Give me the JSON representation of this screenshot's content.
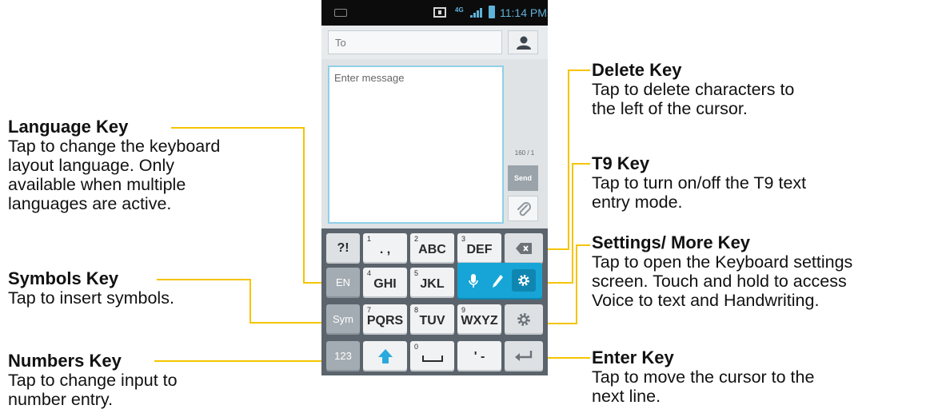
{
  "colors": {
    "leader": "#f5c400",
    "accent": "#16a5d6",
    "status_text": "#5fb2d9"
  },
  "callouts": {
    "language": {
      "title": "Language Key",
      "lines": [
        "Tap to change the keyboard",
        "layout language. Only",
        "available when multiple",
        "languages are active."
      ]
    },
    "symbols": {
      "title": "Symbols Key",
      "lines": [
        "Tap to insert symbols."
      ]
    },
    "numbers": {
      "title": "Numbers Key",
      "lines": [
        "Tap to change input to",
        "number entry."
      ]
    },
    "delete": {
      "title": "Delete Key",
      "lines": [
        "Tap to delete characters to",
        "the left of the cursor."
      ]
    },
    "t9": {
      "title": "T9 Key",
      "lines": [
        "Tap to turn on/off the T9 text",
        "entry mode."
      ]
    },
    "settings": {
      "title": "Settings/ More Key",
      "lines": [
        "Tap to open the Keyboard settings",
        "screen. Touch and hold to access",
        "Voice to text and Handwriting."
      ]
    },
    "enter": {
      "title": "Enter Key",
      "lines": [
        "Tap to move the cursor to the",
        "next line."
      ]
    }
  },
  "phone": {
    "status": {
      "network": "4G",
      "time": "11:14 PM",
      "icons": [
        "keyboard-icon",
        "sim-icon",
        "signal-icon",
        "battery-icon"
      ]
    },
    "to_placeholder": "To",
    "message_placeholder": "Enter message",
    "counter": "160 / 1",
    "send_label": "Send",
    "icons": [
      "contact-icon",
      "paperclip-icon"
    ]
  },
  "keyboard": {
    "row1": [
      {
        "label": "?!",
        "num": ""
      },
      {
        "label": ". ,",
        "num": "1"
      },
      {
        "label": "ABC",
        "num": "2"
      },
      {
        "label": "DEF",
        "num": "3"
      },
      {
        "label": "",
        "icon": "backspace-icon"
      }
    ],
    "row2": [
      {
        "label": "EN",
        "num": ""
      },
      {
        "label": "GHI",
        "num": "4"
      },
      {
        "label": "JKL",
        "num": "5"
      },
      {
        "label": "",
        "icons": [
          "mic-icon",
          "pen-icon",
          "gear-icon"
        ]
      }
    ],
    "row3": [
      {
        "label": "Sym",
        "num": ""
      },
      {
        "label": "PQRS",
        "num": "7"
      },
      {
        "label": "TUV",
        "num": "8"
      },
      {
        "label": "WXYZ",
        "num": "9"
      },
      {
        "label": "",
        "icon": "gear-icon"
      }
    ],
    "row4": [
      {
        "label": "123",
        "num": ""
      },
      {
        "label": "",
        "icon": "shift-arrow-icon"
      },
      {
        "label": "",
        "num": "0",
        "icon": "space-icon"
      },
      {
        "label": "' -",
        "num": ""
      },
      {
        "label": "",
        "icon": "enter-icon"
      }
    ]
  }
}
